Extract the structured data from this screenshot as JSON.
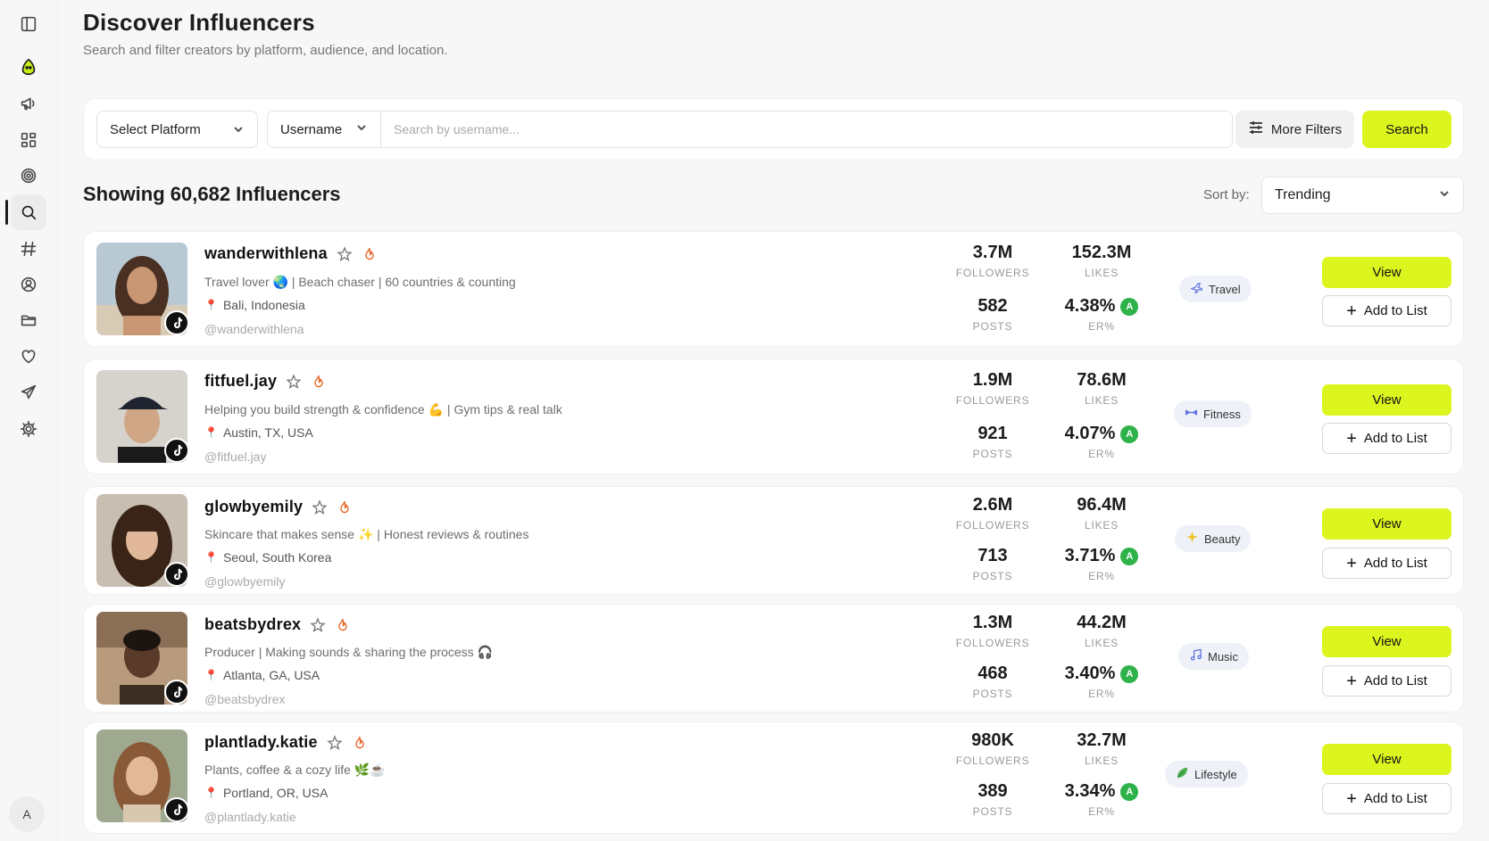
{
  "header": {
    "title": "Discover Influencers",
    "subtitle": "Search and filter creators by platform, audience, and location."
  },
  "search": {
    "platform_label": "Select Platform",
    "field_label": "Username",
    "placeholder": "Search by username...",
    "more_filters_label": "More Filters",
    "search_button_label": "Search"
  },
  "results": {
    "showing_label": "Showing 60,682 Influencers",
    "sort_label": "Sort by:",
    "sort_value": "Trending"
  },
  "sidebar": {
    "items": [
      {
        "icon": "panel-toggle-icon"
      },
      {
        "icon": "logo-icon"
      },
      {
        "icon": "megaphone-icon"
      },
      {
        "icon": "dashboard-icon"
      },
      {
        "icon": "target-icon"
      },
      {
        "icon": "search-icon",
        "active": true
      },
      {
        "icon": "hashtag-icon"
      },
      {
        "icon": "user-circle-icon"
      },
      {
        "icon": "folder-icon"
      },
      {
        "icon": "heart-icon"
      },
      {
        "icon": "send-icon"
      },
      {
        "icon": "settings-icon"
      }
    ],
    "user_initial": "A"
  },
  "labels": {
    "followers": "FOLLOWERS",
    "likes": "LIKES",
    "posts": "POSTS",
    "er": "ER%",
    "view": "View",
    "add_to_list": "Add to List"
  },
  "colors": {
    "accent": "#dcf51f",
    "grade": "#2fb24a",
    "tag_bg": "#eef1f7"
  },
  "influencers": [
    {
      "name": "wanderwithlena",
      "bio": "Travel lover 🌏 | Beach chaser | 60 countries & counting",
      "location": "Bali, Indonesia",
      "handle": "@wanderwithlena",
      "followers": "3.7M",
      "likes": "152.3M",
      "posts": "582",
      "er": "4.38%",
      "grade": "A",
      "category": "Travel",
      "category_icon": "plane-icon",
      "platform": "tiktok"
    },
    {
      "name": "fitfuel.jay",
      "bio": "Helping you build strength & confidence 💪 | Gym tips & real talk",
      "location": "Austin, TX, USA",
      "handle": "@fitfuel.jay",
      "followers": "1.9M",
      "likes": "78.6M",
      "posts": "921",
      "er": "4.07%",
      "grade": "A",
      "category": "Fitness",
      "category_icon": "dumbbell-icon",
      "platform": "tiktok"
    },
    {
      "name": "glowbyemily",
      "bio": "Skincare that makes sense ✨ | Honest reviews & routines",
      "location": "Seoul, South Korea",
      "handle": "@glowbyemily",
      "followers": "2.6M",
      "likes": "96.4M",
      "posts": "713",
      "er": "3.71%",
      "grade": "A",
      "category": "Beauty",
      "category_icon": "sparkle-icon",
      "platform": "tiktok"
    },
    {
      "name": "beatsbydrex",
      "bio": "Producer | Making sounds & sharing the process 🎧",
      "location": "Atlanta, GA, USA",
      "handle": "@beatsbydrex",
      "followers": "1.3M",
      "likes": "44.2M",
      "posts": "468",
      "er": "3.40%",
      "grade": "A",
      "category": "Music",
      "category_icon": "music-note-icon",
      "platform": "tiktok"
    },
    {
      "name": "plantlady.katie",
      "bio": "Plants, coffee & a cozy life 🌿☕",
      "location": "Portland, OR, USA",
      "handle": "@plantlady.katie",
      "followers": "980K",
      "likes": "32.7M",
      "posts": "389",
      "er": "3.34%",
      "grade": "A",
      "category": "Lifestyle",
      "category_icon": "leaf-icon",
      "platform": "tiktok"
    }
  ]
}
